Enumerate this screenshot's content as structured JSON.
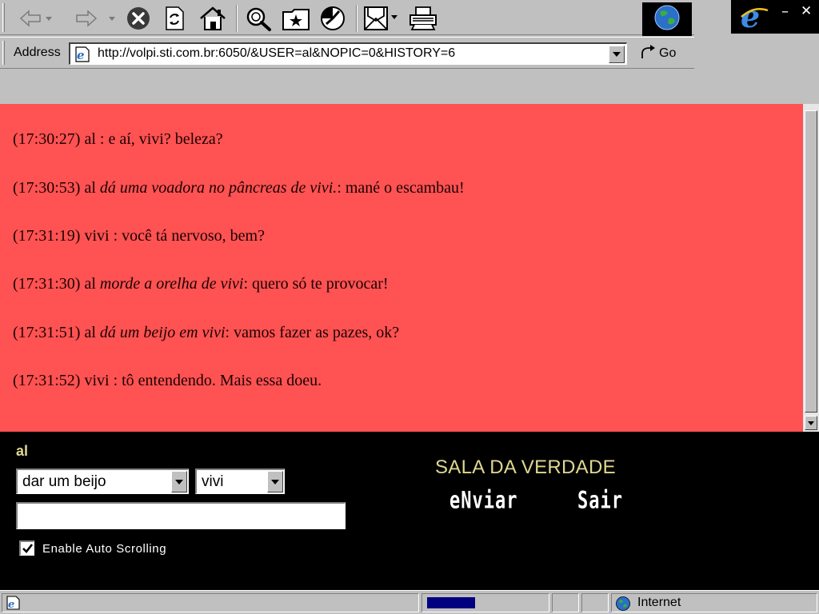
{
  "browser": {
    "address_label": "Address",
    "url": "http://volpi.sti.com.br:6050/&USER=al&NOPIC=0&HISTORY=6",
    "go_label": "Go",
    "window_minimize": "–",
    "window_close": "✕",
    "toolbar_icons": [
      "back-icon",
      "forward-icon",
      "stop-icon",
      "refresh-icon",
      "home-icon",
      "search-icon",
      "favorites-icon",
      "history-icon",
      "mail-icon",
      "print-icon"
    ]
  },
  "chat": {
    "messages": [
      {
        "time": "(17:30:27)",
        "user": "al",
        "action": "",
        "sep": " : ",
        "text": "e aí, vivi? beleza?"
      },
      {
        "time": "(17:30:53)",
        "user": "al",
        "action": "dá uma voadora no pâncreas de vivi.",
        "sep": ": ",
        "text": "mané o escambau!"
      },
      {
        "time": "(17:31:19)",
        "user": "vivi",
        "action": "",
        "sep": " : ",
        "text": "você tá nervoso, bem?"
      },
      {
        "time": "(17:31:30)",
        "user": "al",
        "action": "morde a orelha de vivi",
        "sep": ": ",
        "text": "quero só te provocar!"
      },
      {
        "time": "(17:31:51)",
        "user": "al",
        "action": "dá um beijo em vivi",
        "sep": ": ",
        "text": "vamos fazer as pazes, ok?"
      },
      {
        "time": "(17:31:52)",
        "user": "vivi",
        "action": "",
        "sep": " : ",
        "text": "tô entendendo. Mais essa doeu."
      }
    ],
    "background_color": "#ff5252"
  },
  "input_panel": {
    "username": "al",
    "action_select": "dar um beijo",
    "target_select": "vivi",
    "message_value": "",
    "auto_scroll_label": "Enable Auto Scrolling",
    "auto_scroll_checked": true,
    "room_title": "SALA DA VERDADE",
    "send_label": "eNviar",
    "exit_label": "Sair",
    "accent_color": "#e0d890"
  },
  "status": {
    "zone": "Internet"
  }
}
